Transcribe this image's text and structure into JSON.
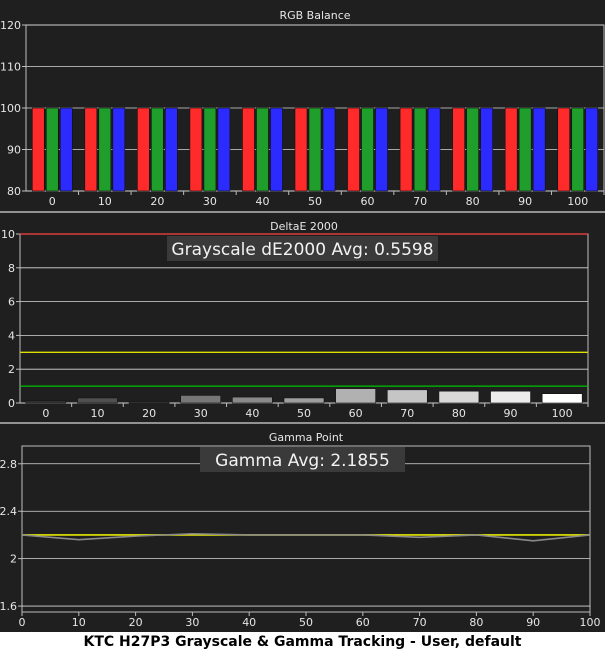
{
  "chart_data": [
    {
      "type": "bar",
      "title": "RGB Balance",
      "categories": [
        "0",
        "10",
        "20",
        "30",
        "40",
        "50",
        "60",
        "70",
        "80",
        "90",
        "100"
      ],
      "ylim": [
        80,
        120
      ],
      "yticks": [
        "80",
        "90",
        "100",
        "110",
        "120"
      ],
      "series": [
        {
          "color": "#ff2a2a",
          "values": [
            100,
            100,
            100,
            100,
            100,
            100,
            100,
            100,
            100,
            100,
            100
          ]
        },
        {
          "color": "#1f9e2c",
          "values": [
            100,
            100,
            100,
            100,
            100,
            100,
            100,
            100,
            100,
            100,
            100
          ]
        },
        {
          "color": "#2b2bff",
          "values": [
            100,
            100,
            100,
            100,
            100,
            100,
            100,
            100,
            100,
            100,
            100
          ]
        }
      ],
      "grid": true
    },
    {
      "type": "bar",
      "title": "DeltaE 2000",
      "categories": [
        "0",
        "10",
        "20",
        "30",
        "40",
        "50",
        "60",
        "70",
        "80",
        "90",
        "100"
      ],
      "values": [
        0.12,
        0.3,
        0.05,
        0.45,
        0.35,
        0.3,
        0.85,
        0.78,
        0.7,
        0.7,
        0.55
      ],
      "ylim": [
        0,
        10
      ],
      "yticks": [
        "0",
        "2",
        "4",
        "6",
        "8",
        "10"
      ],
      "thresholds": [
        {
          "value": 10,
          "color": "#ff4040"
        },
        {
          "value": 3,
          "color": "#e0e000"
        },
        {
          "value": 1,
          "color": "#00c000"
        }
      ],
      "annotation": "Grayscale dE2000 Avg: 0.5598",
      "grid": true
    },
    {
      "type": "line",
      "title": "Gamma Point",
      "x": [
        0,
        10,
        20,
        30,
        40,
        50,
        60,
        70,
        80,
        90,
        100
      ],
      "ticks": [
        "0",
        "10",
        "20",
        "30",
        "40",
        "50",
        "60",
        "70",
        "80",
        "90",
        "100"
      ],
      "series": [
        {
          "color": "#e8e800",
          "values": [
            2.2,
            2.2,
            2.2,
            2.2,
            2.2,
            2.2,
            2.2,
            2.2,
            2.2,
            2.2,
            2.2
          ]
        },
        {
          "color": "#8a8a8a",
          "values": [
            2.2,
            2.16,
            2.19,
            2.21,
            2.2,
            2.2,
            2.2,
            2.18,
            2.2,
            2.15,
            2.2
          ]
        }
      ],
      "ylim": [
        1.55,
        2.95
      ],
      "yticks": [
        "1.6",
        "2",
        "2.4",
        "2.8"
      ],
      "annotation": "Gamma Avg: 2.1855",
      "grid": true
    }
  ],
  "caption": "KTC H27P3 Grayscale & Gamma Tracking - User, default"
}
